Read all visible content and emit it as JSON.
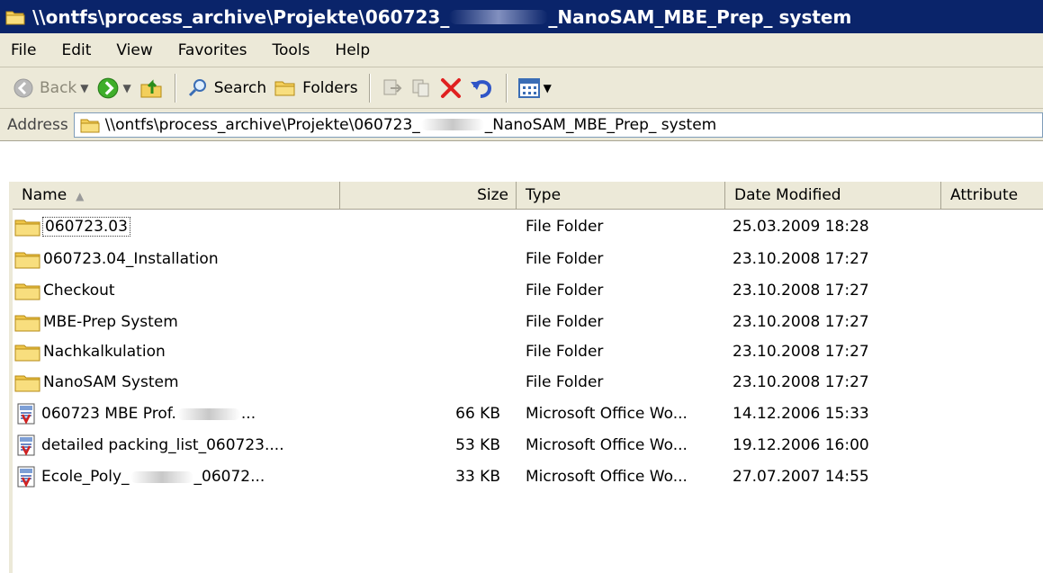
{
  "window": {
    "title_prefix": "\\\\ontfs\\process_archive\\Projekte\\060723_",
    "title_suffix": "_NanoSAM_MBE_Prep_ system"
  },
  "menu": [
    "File",
    "Edit",
    "View",
    "Favorites",
    "Tools",
    "Help"
  ],
  "toolbar": {
    "back_label": "Back",
    "search_label": "Search",
    "folders_label": "Folders"
  },
  "address": {
    "label": "Address",
    "path_prefix": "\\\\ontfs\\process_archive\\Projekte\\060723_",
    "path_suffix": "_NanoSAM_MBE_Prep_ system"
  },
  "columns": {
    "name": "Name",
    "size": "Size",
    "type": "Type",
    "date": "Date Modified",
    "attributes": "Attribute"
  },
  "files": [
    {
      "name": "060723.03",
      "size": "",
      "type": "File Folder",
      "date": "25.03.2009 18:28",
      "kind": "folder"
    },
    {
      "name": "060723.04_Installation",
      "size": "",
      "type": "File Folder",
      "date": "23.10.2008 17:27",
      "kind": "folder"
    },
    {
      "name": "Checkout",
      "size": "",
      "type": "File Folder",
      "date": "23.10.2008 17:27",
      "kind": "folder"
    },
    {
      "name": "MBE-Prep System",
      "size": "",
      "type": "File Folder",
      "date": "23.10.2008 17:27",
      "kind": "folder"
    },
    {
      "name": "Nachkalkulation",
      "size": "",
      "type": "File Folder",
      "date": "23.10.2008 17:27",
      "kind": "folder"
    },
    {
      "name": "NanoSAM System",
      "size": "",
      "type": "File Folder",
      "date": "23.10.2008 17:27",
      "kind": "folder"
    },
    {
      "name_prefix": "060723 MBE Prof.",
      "name_suffix": " ...",
      "size": "66 KB",
      "type": "Microsoft Office Wo...",
      "date": "14.12.2006 15:33",
      "kind": "doc"
    },
    {
      "name": "detailed packing_list_060723....",
      "size": "53 KB",
      "type": "Microsoft Office Wo...",
      "date": "19.12.2006 16:00",
      "kind": "doc"
    },
    {
      "name_prefix": "Ecole_Poly_",
      "name_suffix": "_06072...",
      "size": "33 KB",
      "type": "Microsoft Office Wo...",
      "date": "27.07.2007 14:55",
      "kind": "doc"
    }
  ],
  "colors": {
    "titlebar": "#0a246a",
    "chrome": "#ece9d8",
    "folder": "#f5d76e",
    "delete_red": "#e02020"
  }
}
